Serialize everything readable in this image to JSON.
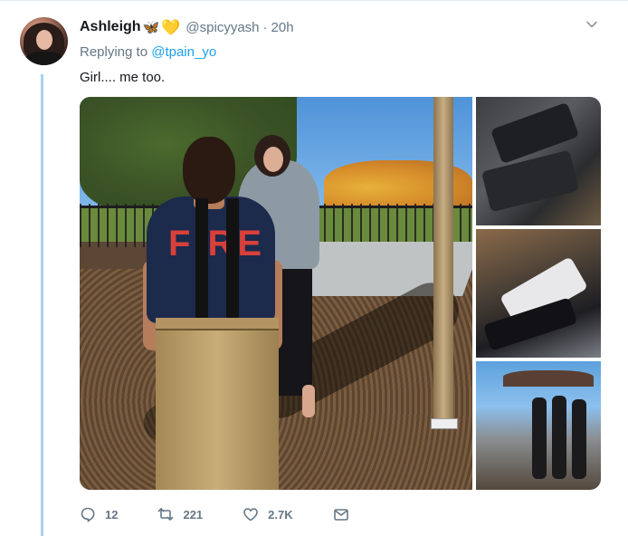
{
  "tweet": {
    "author_name": "Ashleigh",
    "emoji": [
      "🦋",
      "💛"
    ],
    "handle": "@spicyyash",
    "separator": "·",
    "time": "20h",
    "replying_to_prefix": "Replying to",
    "replying_to_handle": "@tpain_yo",
    "text": "Girl.... me too."
  },
  "actions": {
    "replies": "12",
    "retweets": "221",
    "likes": "2.7K"
  },
  "media": {
    "main_photo_text": "FIRE",
    "photo_count": 4
  },
  "colors": {
    "accent": "#1da1f2",
    "secondary_text": "#657786",
    "thread_line": "#a8cff2"
  },
  "icons": {
    "reply": "reply-icon",
    "retweet": "retweet-icon",
    "like": "heart-icon",
    "dm": "envelope-icon",
    "menu": "chevron-down-icon"
  }
}
